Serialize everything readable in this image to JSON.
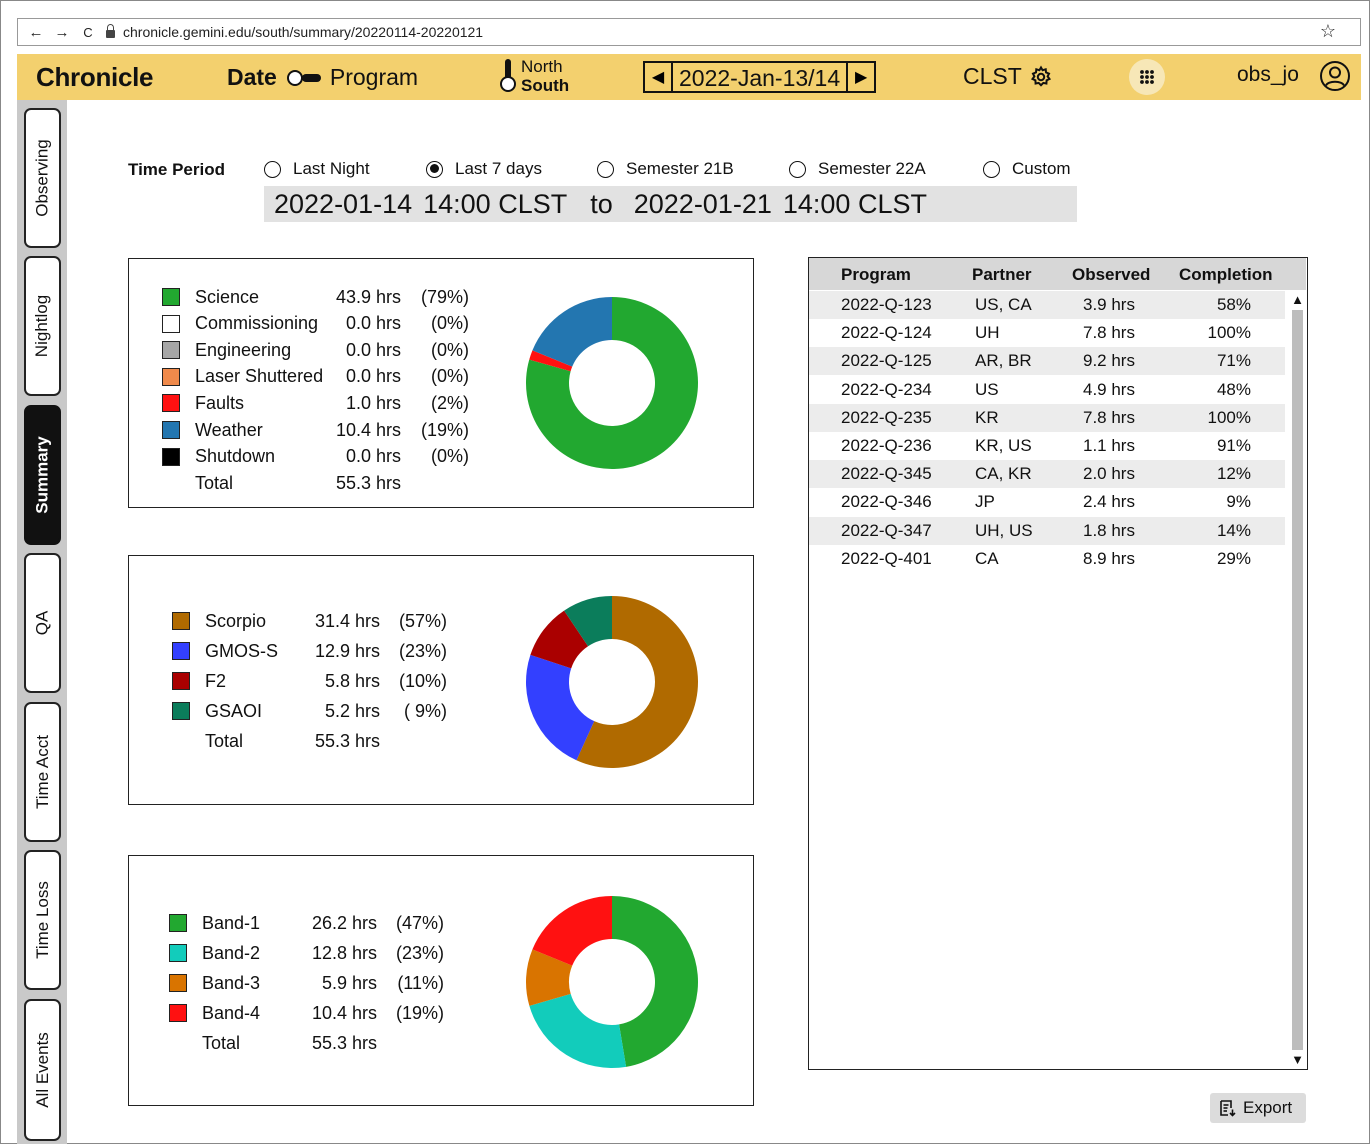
{
  "browser": {
    "url": "chronicle.gemini.edu/south/summary/20220114-20220121",
    "back": "←",
    "forward": "→",
    "reload": "C",
    "bookmark": "☆"
  },
  "header": {
    "brand": "Chronicle",
    "mode_date": "Date",
    "mode_program": "Program",
    "site_north": "North",
    "site_south": "South",
    "date": "2022-Jan-13/14",
    "timezone": "CLST",
    "username": "obs_jo",
    "accent_color": "#f3d06e"
  },
  "sidebar": {
    "tabs": [
      {
        "label": "Observing"
      },
      {
        "label": "Nightlog"
      },
      {
        "label": "Summary",
        "active": true
      },
      {
        "label": "QA"
      },
      {
        "label": "Time Acct"
      },
      {
        "label": "Time Loss"
      },
      {
        "label": "All Events"
      }
    ]
  },
  "time_period": {
    "label": "Time Period",
    "options": [
      {
        "label": "Last Night",
        "checked": false
      },
      {
        "label": "Last 7 days",
        "checked": true
      },
      {
        "label": "Semester 21B",
        "checked": false
      },
      {
        "label": "Semester 22A",
        "checked": false
      },
      {
        "label": "Custom",
        "checked": false
      }
    ],
    "range": {
      "start_date": "2022-01-14",
      "start_time": "14:00 CLST",
      "to": "to",
      "end_date": "2022-01-21",
      "end_time": "14:00 CLST"
    }
  },
  "chart_data": [
    {
      "type": "pie",
      "categories": [
        "Science",
        "Commissioning",
        "Engineering",
        "Laser Shuttered",
        "Faults",
        "Weather",
        "Shutdown"
      ],
      "values": [
        43.9,
        0.0,
        0.0,
        0.0,
        1.0,
        10.4,
        0.0
      ],
      "hours_text": [
        "43.9 hrs",
        "0.0 hrs",
        "0.0 hrs",
        "0.0 hrs",
        "1.0 hrs",
        "10.4 hrs",
        "0.0 hrs"
      ],
      "percent_text": [
        "(79%)",
        "(0%)",
        "(0%)",
        "(0%)",
        "(2%)",
        "(19%)",
        "(0%)"
      ],
      "colors": [
        "#22a830",
        "#ffffff",
        "#a6a6a6",
        "#f08a4b",
        "#ff1111",
        "#2376b0",
        "#000000"
      ],
      "total_label": "Total",
      "total_text": "55.3 hrs"
    },
    {
      "type": "pie",
      "categories": [
        "Scorpio",
        "GMOS-S",
        "F2",
        "GSAOI"
      ],
      "values": [
        31.4,
        12.9,
        5.8,
        5.2
      ],
      "hours_text": [
        "31.4 hrs",
        "12.9 hrs",
        "5.8 hrs",
        "5.2 hrs"
      ],
      "percent_text": [
        "(57%)",
        "(23%)",
        "(10%)",
        "( 9%)"
      ],
      "colors": [
        "#b06a00",
        "#3340ff",
        "#aa0000",
        "#0b7d5b"
      ],
      "total_label": "Total",
      "total_text": "55.3 hrs"
    },
    {
      "type": "pie",
      "categories": [
        "Band-1",
        "Band-2",
        "Band-3",
        "Band-4"
      ],
      "values": [
        26.2,
        12.8,
        5.9,
        10.4
      ],
      "hours_text": [
        "26.2 hrs",
        "12.8 hrs",
        "5.9 hrs",
        "10.4 hrs"
      ],
      "percent_text": [
        "(47%)",
        "(23%)",
        "(11%)",
        "(19%)"
      ],
      "colors": [
        "#22a830",
        "#12ccbb",
        "#d97400",
        "#ff1111"
      ],
      "total_label": "Total",
      "total_text": "55.3 hrs"
    }
  ],
  "program_table": {
    "columns": [
      "Program",
      "Partner",
      "Observed",
      "Completion"
    ],
    "rows": [
      [
        "2022-Q-123",
        "US, CA",
        "3.9 hrs",
        "58%"
      ],
      [
        "2022-Q-124",
        "UH",
        "7.8 hrs",
        "100%"
      ],
      [
        "2022-Q-125",
        "AR, BR",
        "9.2 hrs",
        "71%"
      ],
      [
        "2022-Q-234",
        "US",
        "4.9 hrs",
        "48%"
      ],
      [
        "2022-Q-235",
        "KR",
        "7.8 hrs",
        "100%"
      ],
      [
        "2022-Q-236",
        "KR, US",
        "1.1 hrs",
        "91%"
      ],
      [
        "2022-Q-345",
        "CA, KR",
        "2.0 hrs",
        "12%"
      ],
      [
        "2022-Q-346",
        "JP",
        "2.4 hrs",
        "9%"
      ],
      [
        "2022-Q-347",
        "UH, US",
        "1.8 hrs",
        "14%"
      ],
      [
        "2022-Q-401",
        "CA",
        "8.9 hrs",
        "29%"
      ]
    ]
  },
  "export_label": "Export"
}
